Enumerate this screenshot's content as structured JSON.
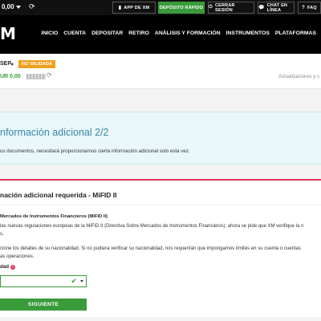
{
  "topbar": {
    "balance": "0,00",
    "buttons": [
      {
        "label": "APP DE XM",
        "icon": "phone-icon"
      },
      {
        "label": "DEPÓSITO RÁPIDO",
        "icon": ""
      },
      {
        "label": "CERRAR SESIÓN",
        "icon": "power-icon"
      },
      {
        "label": "CHAT EN LÍNEA",
        "icon": "chat-icon"
      },
      {
        "label": "FAQ",
        "icon": "help-icon"
      }
    ]
  },
  "nav": {
    "logo": "M",
    "items": [
      "INICIO",
      "CUENTA",
      "DEPOSITAR",
      "RETIRO",
      "ANÁLISIS Y FORMACIÓN",
      "INSTRUMENTOS",
      "PLATAFORMAS"
    ]
  },
  "account": {
    "id": "SEP",
    "status": "NO VALIDADA",
    "balance": "UR 0,00",
    "updates": "Actualizaciones y s"
  },
  "info": {
    "title": "nformación adicional 2/2",
    "text": "us documentos, necesitará proporcionarnos cierta información adicional solo esta vez."
  },
  "mifid": {
    "title": "nación adicional requerida - MiFID II",
    "subtitle": "Mercados de Instrumentos Financieros (MiFID II)",
    "para1_line1": "las nuevas regulaciones europeas de la MiFID II (Directiva Sobre Mercados de Instrumentos Financieros), ahora se pide que XM verifique la n",
    "para1_line2": "s.",
    "para2_line1": "cione los detalles de su nacionalidad. Si no pudiera verificar su nacionalidad, nos requerirán que impongamos límites en su cuenta o cuentas",
    "para2_line2": "as operaciones.",
    "field_label": "dad",
    "submit": "SIGUIENTE"
  },
  "colors": {
    "green": "#3a9b3a",
    "accent_red": "#e0365a",
    "badge_orange": "#f0a020",
    "info_blue": "#3b88a8"
  }
}
